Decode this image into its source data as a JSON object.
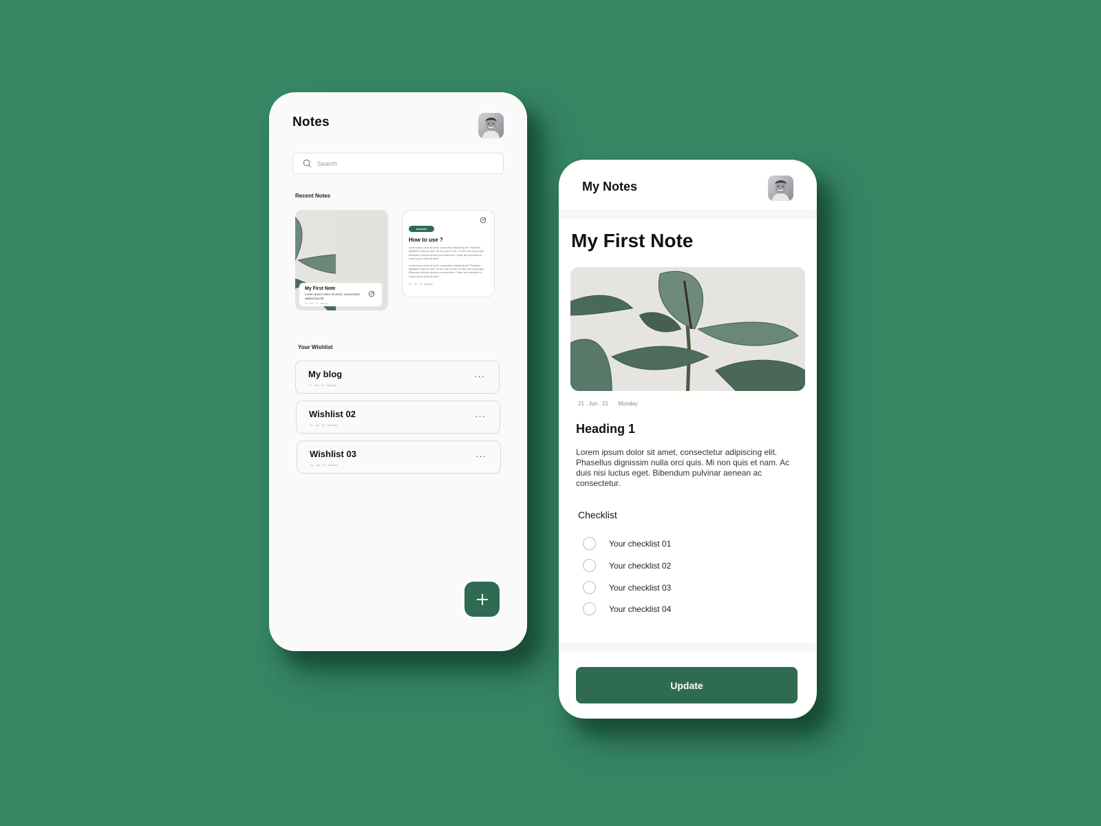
{
  "colors": {
    "background": "#378664",
    "accent": "#2f6b52",
    "card": "#fafafa"
  },
  "notes_screen": {
    "title": "Notes",
    "avatar_icon": "user-avatar",
    "search": {
      "placeholder": "Search",
      "value": "",
      "icon": "search-icon"
    },
    "recent_label": "Recent Notes",
    "recent_notes": [
      {
        "title": "My First Note",
        "excerpt": "Lorem ipsum dolor sit amet, consectetur adipiscing elit.",
        "date": "21 . Jun . 21 · Monday",
        "icon": "edit-icon"
      },
      {
        "badge": "General",
        "title": "How to use ?",
        "paragraphs": [
          "Lorem ipsum dolor sit amet, consectetur adipiscing elit. Phasellus dignissim nulla orci quis. Mi non quis et nam. Ac duis nisi luctus eget. Bibendum pulvinar aenean ac consectetur. Turpis sed vulputate eu. Lorem ipsum dolor sit amet.",
          "Lorem ipsum dolor sit amet, consectetur adipiscing elit. Phasellus dignissim nulla orci quis. Mi non quis et nam. Ac duis nisi luctus eget. Bibendum pulvinar aenean ac consectetur. Turpis sed vulputate eu. Lorem ipsum dolor sit amet."
        ],
        "date": "21 . Jun . 21 · Monday",
        "icon": "edit-icon"
      }
    ],
    "wishlist_label": "Your Wishlist",
    "wishlist": [
      {
        "title": "My blog",
        "date": "21 . Jan . 21 · Monday",
        "more": "···"
      },
      {
        "title": "Wishlist 02",
        "date": "21 . Jan . 21 · Monday",
        "more": "···"
      },
      {
        "title": "Wishlist 03",
        "date": "21 . Jan . 21 · Monday",
        "more": "···"
      }
    ],
    "fab_icon": "plus-icon"
  },
  "detail_screen": {
    "header_title": "My Notes",
    "note_title": "My First Note",
    "date": "21 . Jun . 21",
    "weekday": "Monday",
    "heading": "Heading 1",
    "body": "Lorem ipsum dolor sit amet, consectetur adipiscing elit. Phasellus dignissim nulla orci quis. Mi non quis et nam. Ac duis nisi luctus eget. Bibendum pulvinar aenean ac consectetur.",
    "checklist_title": "Checklist",
    "checklist": [
      {
        "label": "Your checklist 01",
        "checked": false
      },
      {
        "label": "Your checklist 02",
        "checked": false
      },
      {
        "label": "Your checklist 03",
        "checked": false
      },
      {
        "label": "Your checklist 04",
        "checked": false
      }
    ],
    "update_label": "Update"
  }
}
